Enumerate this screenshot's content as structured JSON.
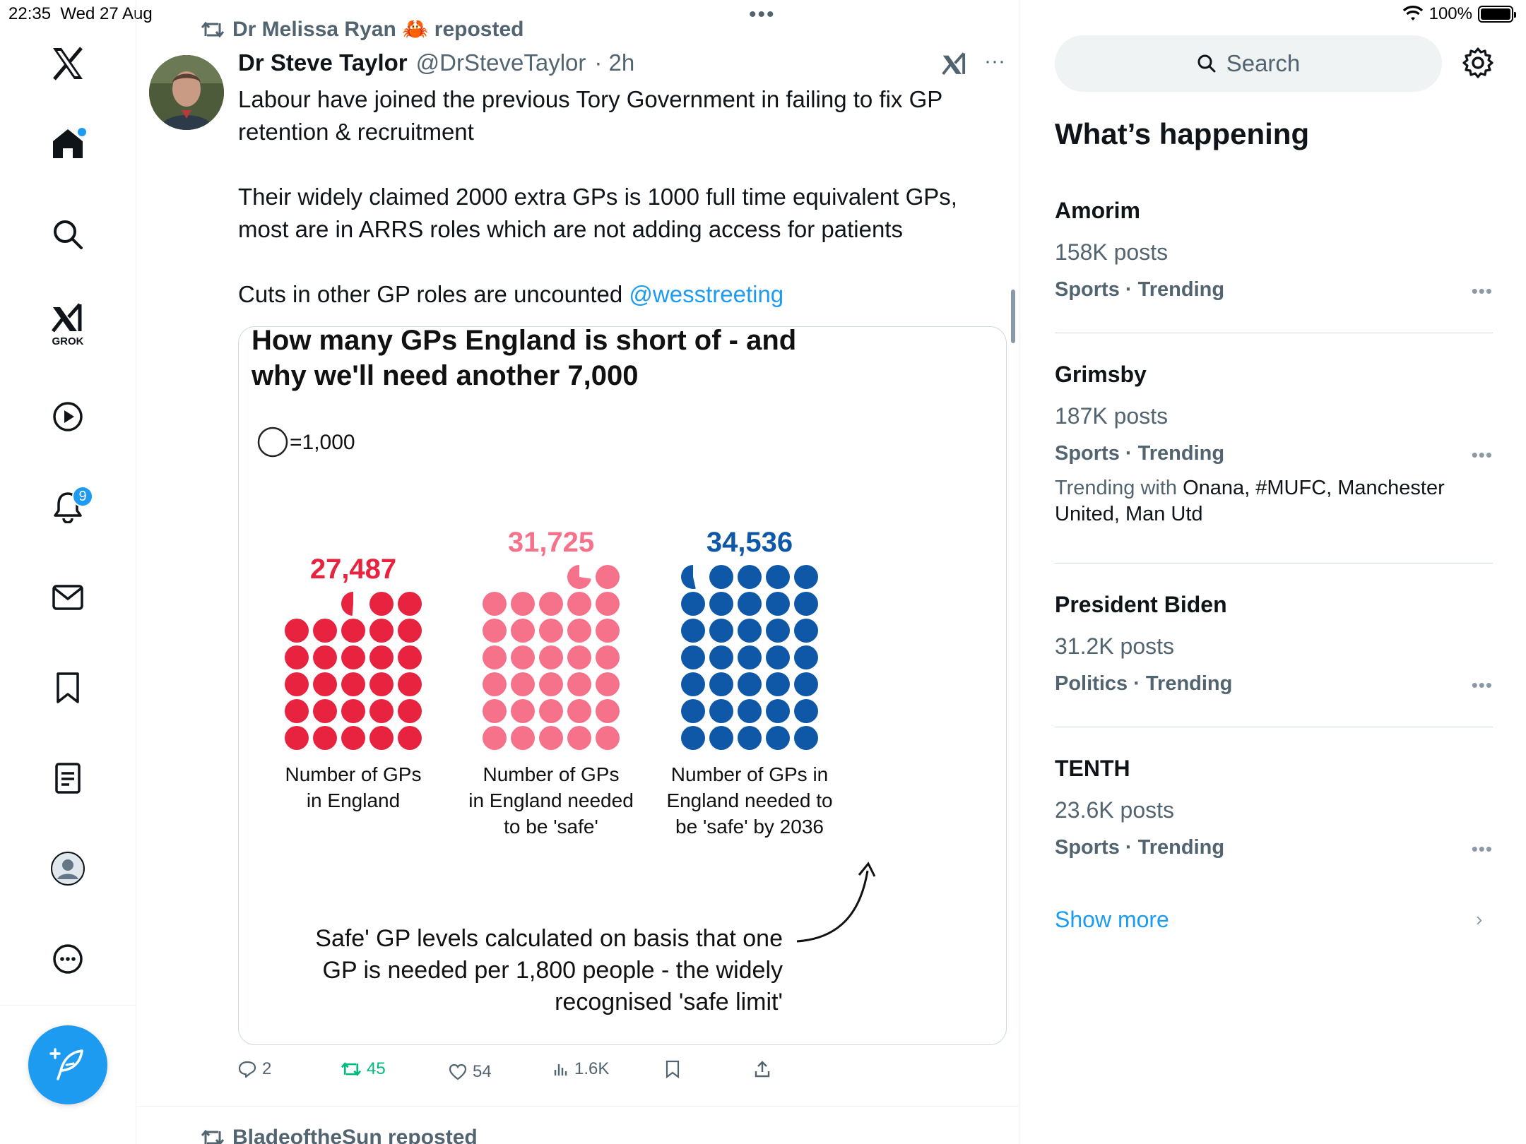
{
  "status": {
    "time": "22:35",
    "date": "Wed 27 Aug",
    "battery": "100%",
    "battery_level": 1.0
  },
  "nav": {
    "grok_label": "GROK",
    "notifications_badge": "9"
  },
  "tweet": {
    "reposted_by": "Dr Melissa Ryan 🦀 reposted",
    "author_name": "Dr Steve Taylor",
    "author_handle": "@DrSteveTaylor",
    "time": "· 2h",
    "text_p1": "Labour have joined the previous Tory Government in failing to fix GP retention & recruitment",
    "text_p2": "Their widely claimed 2000 extra GPs is 1000 full time equivalent GPs, most are in ARRS roles which are not adding access for patients",
    "text_p3": "Cuts in other GP roles are uncounted",
    "mention": "@wesstreeting",
    "actions": {
      "replies": "2",
      "reposts": "45",
      "likes": "54",
      "views": "1.6K"
    }
  },
  "chart_data": {
    "type": "pictogram",
    "title_line1": "How many GPs England is short of - and",
    "title_line2": "why we'll need another 7,000",
    "legend": "=1,000",
    "unit": 1000,
    "columns": [
      {
        "value_label": "27,487",
        "value": 27487,
        "label_lines": [
          "Number of GPs",
          "in England"
        ],
        "color": "#e8233f"
      },
      {
        "value_label": "31,725",
        "value": 31725,
        "label_lines": [
          "Number of GPs",
          "in England needed",
          "to be 'safe'"
        ],
        "color": "#f5728a"
      },
      {
        "value_label": "34,536",
        "value": 34536,
        "label_lines": [
          "Number of GPs in",
          "England needed to",
          "be 'safe' by 2036"
        ],
        "color": "#0f58a8"
      }
    ],
    "note_lines": [
      "Safe' GP levels calculated on basis that one",
      "GP is needed per 1,800 people - the widely",
      "recognised 'safe limit'"
    ]
  },
  "next_item": {
    "reposted_by": "BladeoftheSun reposted"
  },
  "sidebar": {
    "search_placeholder": "Search",
    "section_title": "What’s happening",
    "trends": [
      {
        "name": "Amorim",
        "posts": "158K posts",
        "category": "Sports · Trending"
      },
      {
        "name": "Grimsby",
        "posts": "187K posts",
        "category": "Sports · Trending",
        "with_prefix": "Trending with",
        "with": " Onana, #MUFC, Manchester United, Man Utd"
      },
      {
        "name": "President Biden",
        "posts": "31.2K posts",
        "category": "Politics · Trending"
      },
      {
        "name": "TENTH",
        "posts": "23.6K posts",
        "category": "Sports · Trending"
      }
    ],
    "show_more": "Show more"
  },
  "colors": {
    "accent": "#1d9bf0",
    "repost_green": "#00ba7c"
  }
}
